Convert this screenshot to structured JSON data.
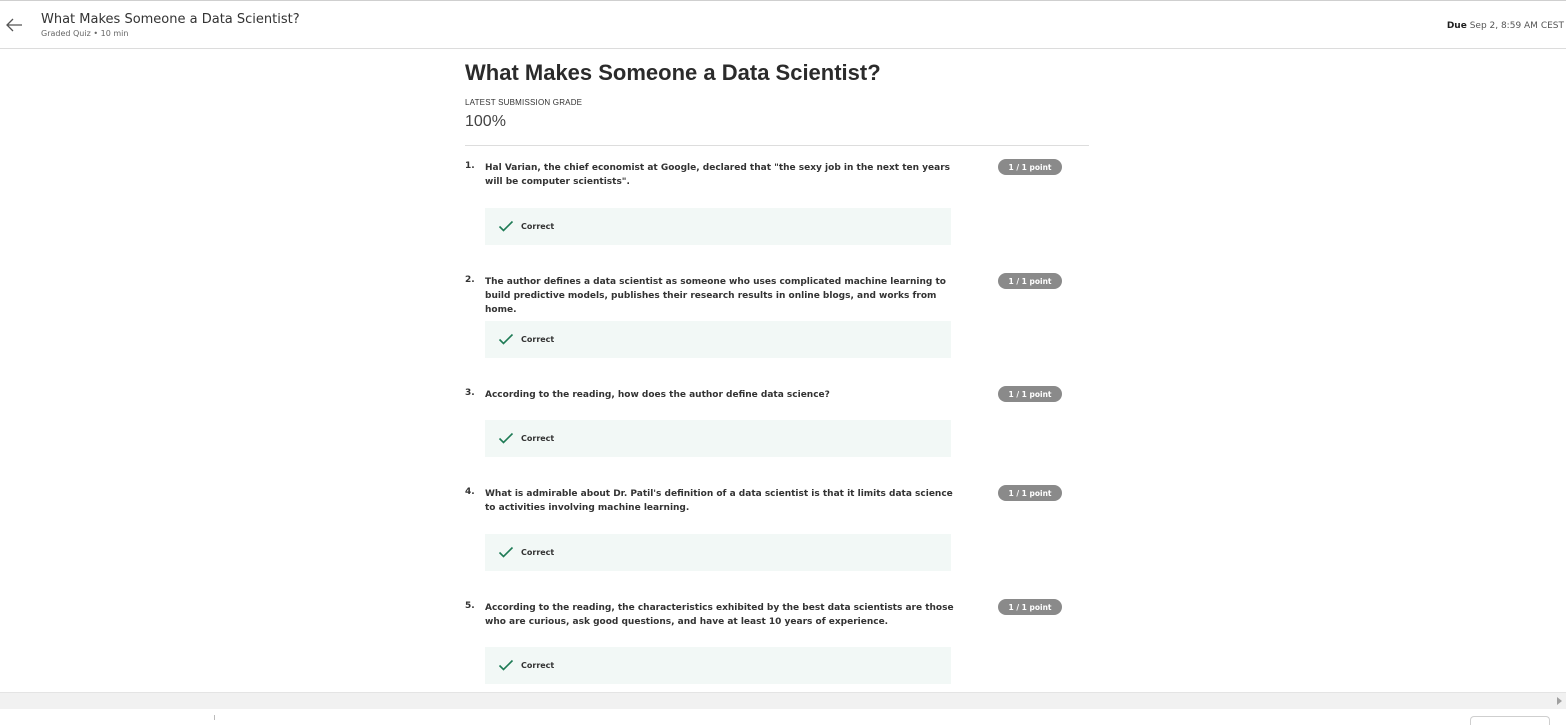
{
  "header": {
    "title": "What Makes Someone a Data Scientist?",
    "subtitle": "Graded Quiz • 10 min",
    "due_label": "Due",
    "due_value": "Sep 2, 8:59 AM CEST"
  },
  "main": {
    "title": "What Makes Someone a Data Scientist?",
    "grade_label": "LATEST SUBMISSION GRADE",
    "grade_value": "100%"
  },
  "questions": [
    {
      "number": "1.",
      "text": "Hal Varian, the chief economist at Google, declared that \"the sexy job in the next ten years will be computer scientists\".",
      "points": "1 / 1 point",
      "feedback": "Correct"
    },
    {
      "number": "2.",
      "text": "The author defines a data scientist as someone who uses complicated machine learning to build predictive models, publishes their research results in online blogs, and works from home.",
      "points": "1 / 1 point",
      "feedback": "Correct"
    },
    {
      "number": "3.",
      "text": "According to the reading, how does the author define data science?",
      "points": "1 / 1 point",
      "feedback": "Correct"
    },
    {
      "number": "4.",
      "text": "What is admirable about Dr. Patil's definition of a data scientist is that it limits data science to activities involving machine learning.",
      "points": "1 / 1 point",
      "feedback": "Correct"
    },
    {
      "number": "5.",
      "text": "According to the reading, the characteristics exhibited by the best data scientists are those who are curious, ask good questions, and have at least 10 years of experience.",
      "points": "1 / 1 point",
      "feedback": "Correct"
    }
  ],
  "colors": {
    "correct_check": "#1e7b55",
    "feedback_bg": "#f2f8f6",
    "points_pill": "#8a8a8a"
  },
  "icons": {
    "back": "arrow-left-icon",
    "correct": "check-icon"
  }
}
